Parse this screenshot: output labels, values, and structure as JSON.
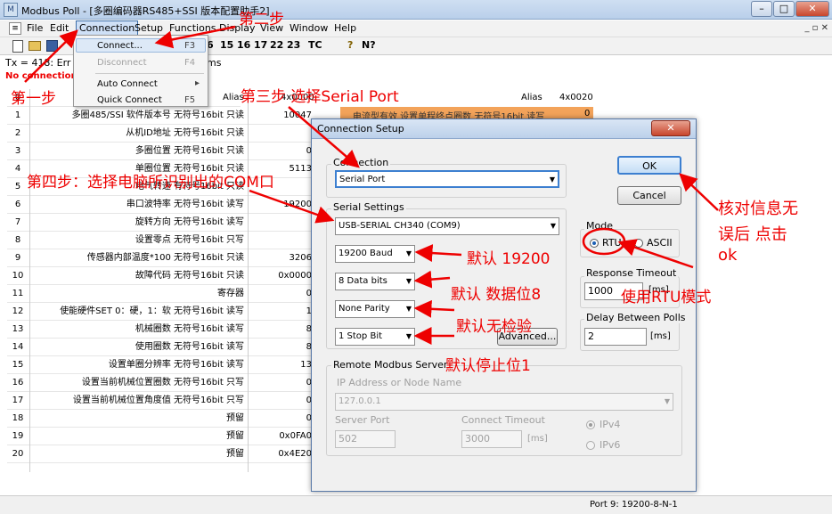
{
  "window": {
    "title": "Modbus Poll - [多圈编码器RS485+SSI 版本配置助手2]",
    "app_icon": "modbus-app-icon",
    "minimize": "–",
    "maximize": "□",
    "close": "✕",
    "mdi_controls": "_ ▫ ✕"
  },
  "menu": [
    "File",
    "Edit",
    "Connection",
    "Setup",
    "Functions",
    "Display",
    "View",
    "Window",
    "Help"
  ],
  "toolbar_items": [
    "6",
    "15",
    "16",
    "17",
    "22",
    "23",
    "TC",
    "?",
    "N?"
  ],
  "status": {
    "tx_line": "Tx = 418: Err =",
    "tx_suffix": "ms",
    "no_connection": "No connection"
  },
  "dropdown_menu": [
    {
      "label": "Connect...",
      "shortcut": "F3",
      "enabled": true
    },
    {
      "label": "Disconnect",
      "shortcut": "F4",
      "enabled": false
    },
    {
      "label": "Auto Connect",
      "shortcut": "▸",
      "enabled": true
    },
    {
      "label": "Quick Connect",
      "shortcut": "F5",
      "enabled": true
    }
  ],
  "table": {
    "alias_header": "Alias",
    "value_header": "4x0000",
    "right_alias_header": "Alias",
    "right_value_header": "4x0020",
    "right_row_0_label": "电流型有效 设置单程终点圈数 无符号16bit 读写",
    "right_row_0_value": "0",
    "rows": [
      {
        "n": "0",
        "label": "",
        "value": ""
      },
      {
        "n": "1",
        "label": "多圈485/SSI  软件版本号 无符号16bit 只读",
        "value": "10047"
      },
      {
        "n": "2",
        "label": "从机ID地址 无符号16bit 只读",
        "value": ""
      },
      {
        "n": "3",
        "label": "多圈位置 无符号16bit 只读",
        "value": "0"
      },
      {
        "n": "4",
        "label": "单圈位置 无符号16bit 只读",
        "value": "5113"
      },
      {
        "n": "5",
        "label": "电气转速 有符号16bit 只读",
        "value": ""
      },
      {
        "n": "6",
        "label": "串口波特率 无符号16bit 读写",
        "value": "19200"
      },
      {
        "n": "7",
        "label": "旋转方向 无符号16bit 读写",
        "value": ""
      },
      {
        "n": "8",
        "label": "设置零点 无符号16bit 只写",
        "value": ""
      },
      {
        "n": "9",
        "label": "传感器内部温度*100 无符号16bit 只读",
        "value": "3206"
      },
      {
        "n": "10",
        "label": "故障代码 无符号16bit 只读",
        "value": "0x0000"
      },
      {
        "n": "11",
        "label": "寄存器",
        "value": "0"
      },
      {
        "n": "12",
        "label": "使能硬件SET 0：硬，1：软 无符号16bit 读写",
        "value": "1"
      },
      {
        "n": "13",
        "label": "机械圈数 无符号16bit 读写",
        "value": "8"
      },
      {
        "n": "14",
        "label": "使用圈数 无符号16bit 读写",
        "value": "8"
      },
      {
        "n": "15",
        "label": "设置单圈分辨率 无符号16bit 读写",
        "value": "13"
      },
      {
        "n": "16",
        "label": "设置当前机械位置圈数 无符号16bit 只写",
        "value": "0"
      },
      {
        "n": "17",
        "label": "设置当前机械位置角度值 无符号16bit 只写",
        "value": "0"
      },
      {
        "n": "18",
        "label": "预留",
        "value": "0"
      },
      {
        "n": "19",
        "label": "预留",
        "value": "0x0FA0"
      },
      {
        "n": "20",
        "label": "预留",
        "value": "0x4E20"
      }
    ]
  },
  "dialog": {
    "title": "Connection Setup",
    "close": "✕",
    "connection_group": "Connection",
    "connection_value": "Serial Port",
    "serial_settings_group": "Serial Settings",
    "port_value": "USB-SERIAL CH340 (COM9)",
    "baud_value": "19200 Baud",
    "data_bits_value": "8 Data bits",
    "parity_value": "None Parity",
    "stop_bits_value": "1 Stop Bit",
    "advanced_button": "Advanced...",
    "ok_button": "OK",
    "cancel_button": "Cancel",
    "mode_group": "Mode",
    "mode_rtu": "RTU",
    "mode_ascii": "ASCII",
    "mode_selected": "RTU",
    "response_timeout_group": "Response Timeout",
    "response_timeout_value": "1000",
    "response_timeout_unit": "[ms]",
    "delay_group": "Delay Between Polls",
    "delay_value": "2",
    "delay_unit": "[ms]",
    "remote_group": "Remote Modbus Server",
    "ip_label": "IP Address or Node Name",
    "ip_value": "127.0.0.1",
    "server_port_label": "Server Port",
    "server_port_value": "502",
    "connect_timeout_label": "Connect Timeout",
    "connect_timeout_value": "3000",
    "connect_timeout_unit": "[ms]",
    "ipv4": "IPv4",
    "ipv6": "IPv6"
  },
  "statusbar": {
    "port_info": "Port 9: 19200-8-N-1"
  },
  "annotations": {
    "step1": "第一步",
    "step2": "第二步",
    "step3": "第三步 选择Serial Port",
    "step4": "第四步：选择电脑所识别出的COM口",
    "baud_note": "默认 19200",
    "databits_note": "默认 数据位8",
    "parity_note": "默认无检验",
    "stopbit_note": "默认停止位1",
    "rtu_note": "使用RTU模式",
    "ok_note_1": "核对信息无",
    "ok_note_2": "误后 点击",
    "ok_note_3": "ok"
  },
  "colors": {
    "annotation_red": "#ee0000",
    "alias_header_orange": "#f3a35a",
    "ok_button_highlight": "#3c7fd0"
  }
}
